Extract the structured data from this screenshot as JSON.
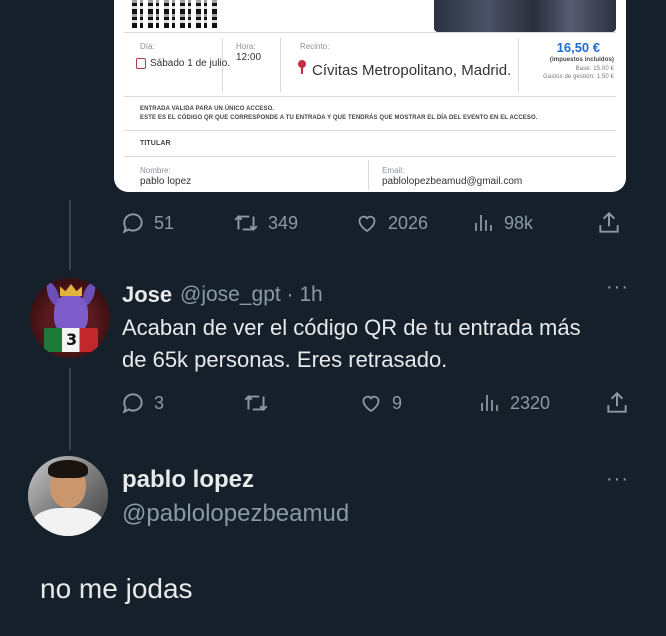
{
  "ticket": {
    "dia_label": "Día:",
    "dia_value": "Sábado 1 de julio.",
    "hora_label": "Hora:",
    "hora_value": "12:00",
    "recinto_label": "Recinto:",
    "recinto_value": "Cívitas Metropolitano, Madrid.",
    "price": "16,50 €",
    "price_note": "(impuestos incluidos)",
    "base": "Base: 15.00 €",
    "gastos": "Gastos de gestión: 1.50 €",
    "entrada_line1": "ENTRADA VALIDA PARA UN ÚNICO ACCESO.",
    "entrada_line2": "ESTE ES EL CÓDIGO QR QUE CORRESPONDE A TU ENTRADA Y QUE TENDRÁS QUE MOSTRAR EL DÍA DEL EVENTO EN EL ACCESO.",
    "titular": "TITULAR",
    "nombre_label": "Nombre:",
    "nombre_value": "pablo lopez",
    "email_label": "Email:",
    "email_value": "pablolopezbeamud@gmail.com"
  },
  "tweet1_actions": {
    "replies": "51",
    "retweets": "349",
    "likes": "2026",
    "views": "98k"
  },
  "reply_jose": {
    "name": "Jose",
    "handle": "@jose_gpt · 1h",
    "text_line1": "Acaban de ver el código QR de tu entrada más",
    "text_line2": "de 65k personas. Eres retrasado.",
    "replies": "3",
    "retweets": "",
    "likes": "9",
    "views": "2320",
    "more": "···"
  },
  "reply_pablo": {
    "name": "pablo lopez",
    "handle": "@pablolopezbeamud",
    "text": "no me jodas",
    "more": "···"
  },
  "colors": {
    "background": "#15202b",
    "text": "#e7e9ea",
    "muted": "#8b98a5",
    "thread_line": "#38444d"
  },
  "icons": [
    "reply-icon",
    "retweet-icon",
    "like-icon",
    "views-icon",
    "share-icon",
    "more-icon",
    "calendar-icon",
    "location-pin-icon"
  ]
}
